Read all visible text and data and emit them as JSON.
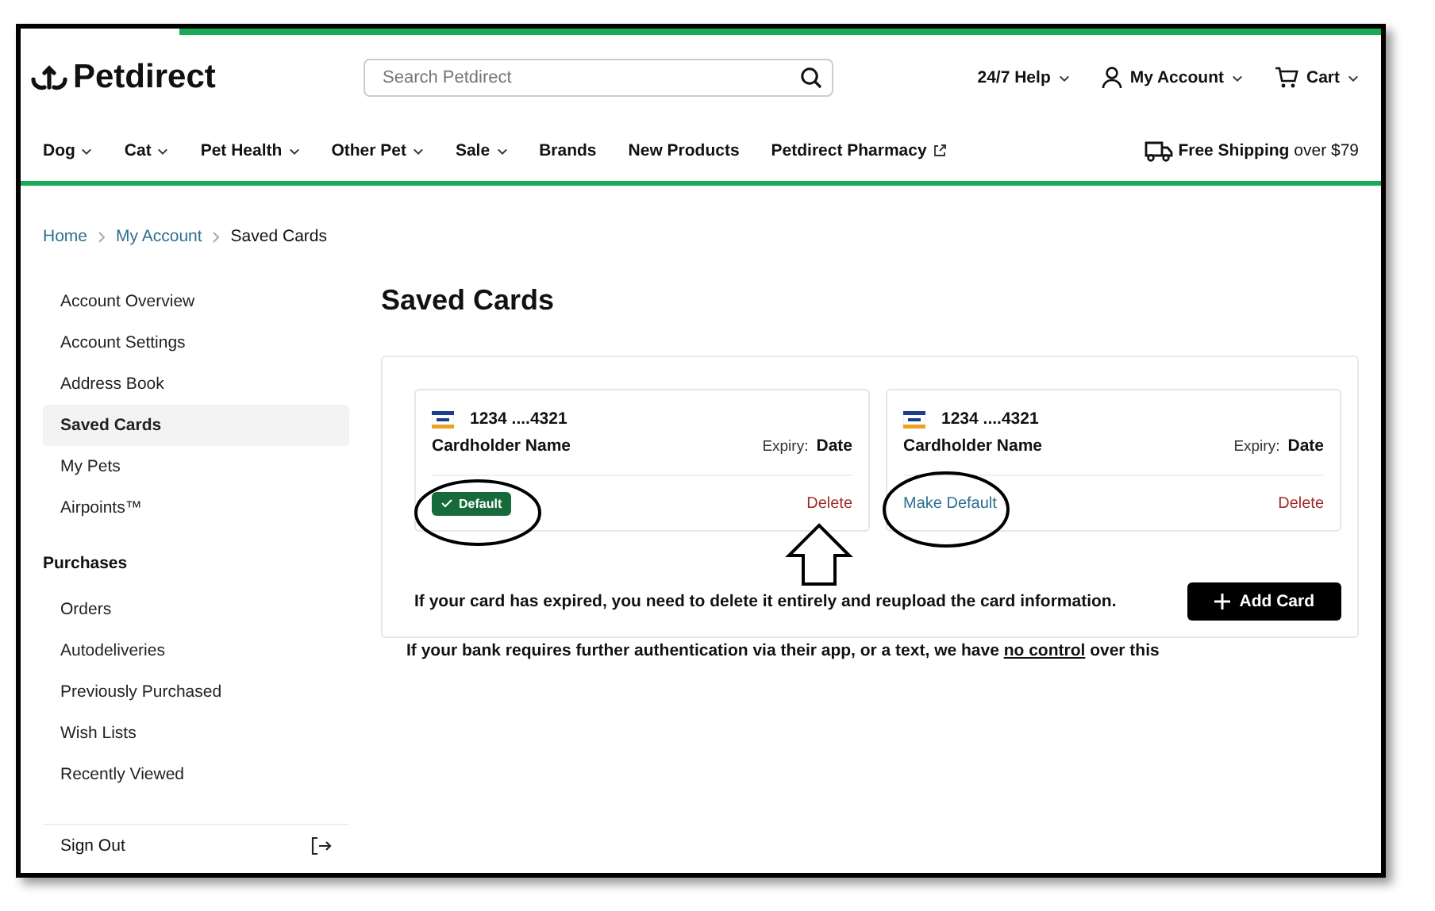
{
  "header": {
    "logo": "Petdirect",
    "search": {
      "placeholder": "Search Petdirect"
    },
    "utility": [
      {
        "kind": "help",
        "label": "24/7 Help"
      },
      {
        "kind": "account",
        "label": "My Account"
      },
      {
        "kind": "cart",
        "label": "Cart"
      }
    ]
  },
  "nav": {
    "items": [
      {
        "label": "Dog",
        "dropdown": true,
        "external": false
      },
      {
        "label": "Cat",
        "dropdown": true,
        "external": false
      },
      {
        "label": "Pet Health",
        "dropdown": true,
        "external": false
      },
      {
        "label": "Other Pet",
        "dropdown": true,
        "external": false
      },
      {
        "label": "Sale",
        "dropdown": true,
        "external": false
      },
      {
        "label": "Brands",
        "dropdown": false,
        "external": false
      },
      {
        "label": "New Products",
        "dropdown": false,
        "external": false
      },
      {
        "label": "Petdirect Pharmacy",
        "dropdown": false,
        "external": true
      }
    ],
    "shipping": "**Free Shipping** over $79"
  },
  "breadcrumb": [
    "Home",
    "My Account",
    "Saved Cards"
  ],
  "sidebar": {
    "items": [
      {
        "label": "Account Overview",
        "selected": false
      },
      {
        "label": "Account Settings",
        "selected": false
      },
      {
        "label": "Address Book",
        "selected": false
      },
      {
        "label": "Saved Cards",
        "selected": true
      },
      {
        "label": "My Pets",
        "selected": false
      },
      {
        "label": "Airpoints™",
        "selected": false
      }
    ],
    "purchases_heading": "Purchases",
    "purchases": [
      {
        "label": "Orders",
        "selected": false
      },
      {
        "label": "Autodeliveries",
        "selected": false
      },
      {
        "label": "Previously Purchased",
        "selected": false
      },
      {
        "label": "Wish Lists",
        "selected": false
      },
      {
        "label": "Recently Viewed",
        "selected": false
      }
    ],
    "sign_out": "Sign Out"
  },
  "page_title": "Saved Cards",
  "cards": [
    {
      "number": "1234 ....4321",
      "holder": "Cardholder Name",
      "expiry_label": "Expiry:",
      "expiry": "Date",
      "status": {
        "kind": "badge",
        "label": "Default"
      },
      "delete": "Delete"
    },
    {
      "number": "1234 ....4321",
      "holder": "Cardholder Name",
      "expiry_label": "Expiry:",
      "expiry": "Date",
      "status": {
        "kind": "link",
        "label": "Make Default"
      },
      "delete": "Delete"
    }
  ],
  "note_expired": "If your card has expired, you need to delete it entirely and reupload the card information.",
  "add_card": "Add Card",
  "note_bank": {
    "before": "If your bank requires further authentication via their app, or a text, we have ",
    "underlined": "no control",
    "after": " over this"
  }
}
